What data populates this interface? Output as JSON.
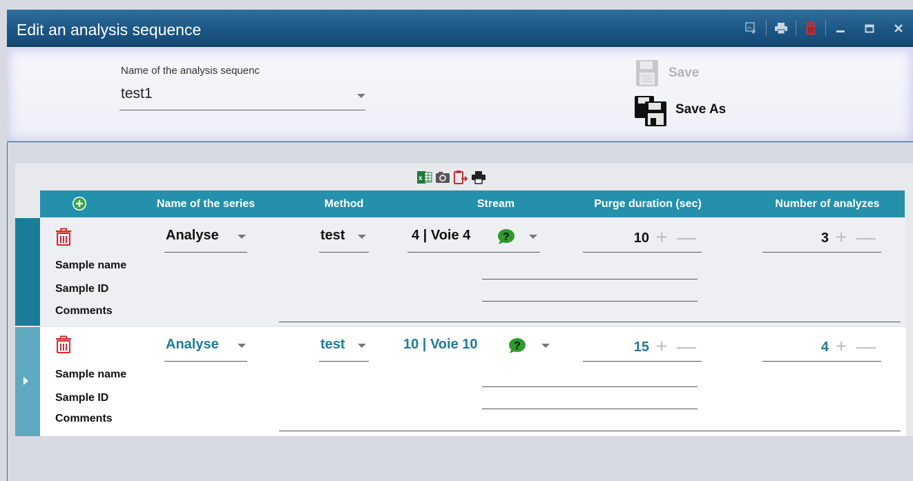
{
  "window": {
    "title": "Edit an analysis sequence",
    "title_icons": [
      "export-image-icon",
      "print-icon",
      "delete-icon",
      "minimize-icon",
      "maximize-icon",
      "close-icon"
    ]
  },
  "header": {
    "sequence_label": "Name of the analysis sequenc",
    "sequence_value": "test1",
    "save_label": "Save",
    "save_as_label": "Save As"
  },
  "toolbar": {
    "icons": [
      "excel-icon",
      "camera-icon",
      "export-clipboard-icon",
      "print-icon"
    ]
  },
  "grid": {
    "columns": [
      "Name of the series",
      "Method",
      "Stream",
      "Purge duration (sec)",
      "Number of analyzes"
    ],
    "sub_labels": [
      "Sample name",
      "Sample ID",
      "Comments"
    ],
    "rows": [
      {
        "series": "Analyse",
        "method": "test",
        "stream": "4 | Voie 4",
        "purge": "10",
        "analyzes": "3"
      },
      {
        "series": "Analyse",
        "method": "test",
        "stream": "10 | Voie 10",
        "purge": "15",
        "analyzes": "4"
      }
    ],
    "plus": "+",
    "minus": "—"
  },
  "colors": {
    "titlebar": "#1b5482",
    "header_bg": "#2490ac",
    "row_accent": "#1b7c98",
    "row2_text": "#1f7a96",
    "trash_red": "#d9272e",
    "help_green": "#2e9a2c"
  }
}
